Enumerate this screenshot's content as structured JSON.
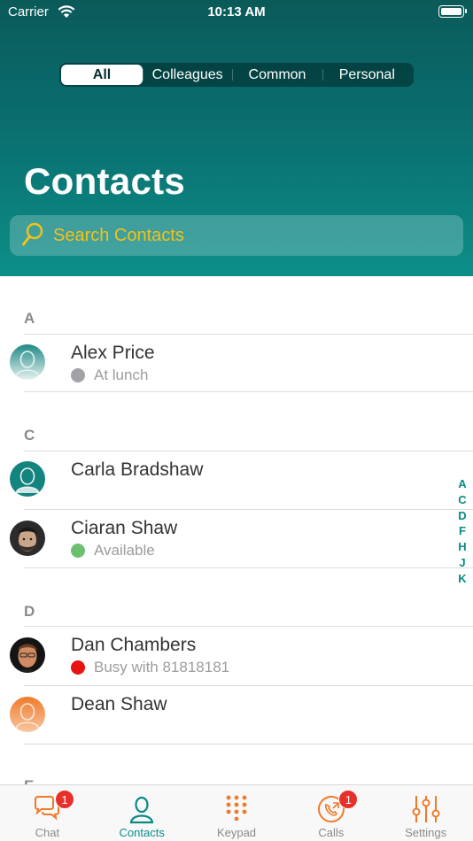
{
  "status_bar": {
    "carrier": "Carrier",
    "time": "10:13 AM"
  },
  "filter": {
    "tabs": [
      "All",
      "Colleagues",
      "Common",
      "Personal"
    ],
    "selected": "All"
  },
  "title": "Contacts",
  "search": {
    "placeholder": "Search Contacts"
  },
  "sections": [
    {
      "letter": "A",
      "contacts": [
        {
          "name": "Alex Price",
          "status": "At lunch",
          "status_color": "#a2a2a7",
          "avatar": "teal-placeholder"
        }
      ]
    },
    {
      "letter": "C",
      "contacts": [
        {
          "name": "Carla Bradshaw",
          "status": "",
          "avatar": "teal-placeholder"
        },
        {
          "name": "Ciaran Shaw",
          "status": "Available",
          "status_color": "#6cc070",
          "avatar": "photo"
        }
      ]
    },
    {
      "letter": "D",
      "contacts": [
        {
          "name": "Dan Chambers",
          "status": "Busy with 81818181",
          "status_color": "#e81212",
          "avatar": "photo"
        },
        {
          "name": "Dean Shaw",
          "status": "",
          "avatar": "orange-placeholder"
        }
      ]
    },
    {
      "letter": "E",
      "contacts": []
    }
  ],
  "index_letters": [
    "A",
    "C",
    "D",
    "F",
    "H",
    "J",
    "K"
  ],
  "tabbar": {
    "tabs": [
      {
        "label": "Chat",
        "icon": "chat-icon",
        "badge": "1"
      },
      {
        "label": "Contacts",
        "icon": "contacts-icon",
        "active": true
      },
      {
        "label": "Keypad",
        "icon": "keypad-icon"
      },
      {
        "label": "Calls",
        "icon": "calls-icon",
        "badge": "1"
      },
      {
        "label": "Settings",
        "icon": "settings-icon"
      }
    ]
  },
  "colors": {
    "accent": "#0a8a86",
    "orange": "#f07a2a",
    "search_text": "#f2c21a",
    "badge": "#e8302a"
  }
}
